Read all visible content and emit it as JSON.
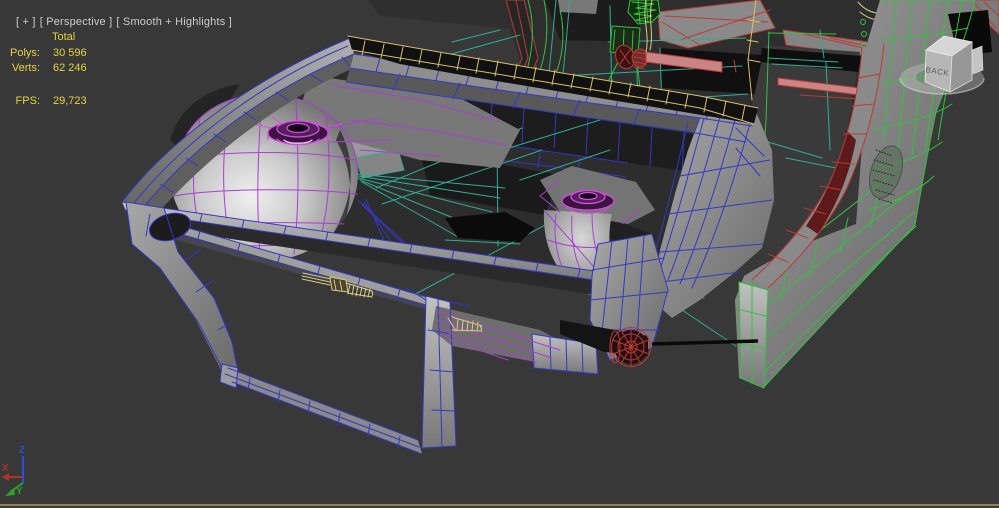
{
  "viewport": {
    "menu": {
      "general": "[ + ]",
      "pov": "[ Perspective ]",
      "shading": "[ Smooth + Highlights ]"
    },
    "stats": {
      "header": "Total",
      "rows": [
        {
          "label": "Polys:",
          "value": "30 596"
        },
        {
          "label": "Verts:",
          "value": "62 246"
        }
      ],
      "fps_label": "FPS:",
      "fps_value": "29,723"
    },
    "colors": {
      "background": "#383838",
      "stats_text": "#e7d341",
      "label_text": "#cdcdcd",
      "viewport_edge": "#8f8448"
    }
  },
  "viewcube": {
    "back_label": "BACK"
  },
  "axis_tripod": {
    "x_label": "X",
    "y_label": "Y",
    "z_label": "Z",
    "x_color": "#b03224",
    "y_color": "#2f9e2f",
    "z_color": "#2a50d8"
  },
  "model": {
    "description": "Car unibody chassis, wireframe over smooth+highlights shading",
    "wire_colors": {
      "body_blue": "#3636c4",
      "strut_purple": "#a93ed2",
      "hub_magenta": "#d44ee0",
      "brace_teal": "#2fae92",
      "shell_green": "#33c23e",
      "frame_red": "#bc3a34",
      "maroon_dark": "#5c1a1a",
      "accent_yellow": "#d9c16b",
      "bolt_yellow": "#d9cc82",
      "rod_pink": "#c98585"
    }
  }
}
